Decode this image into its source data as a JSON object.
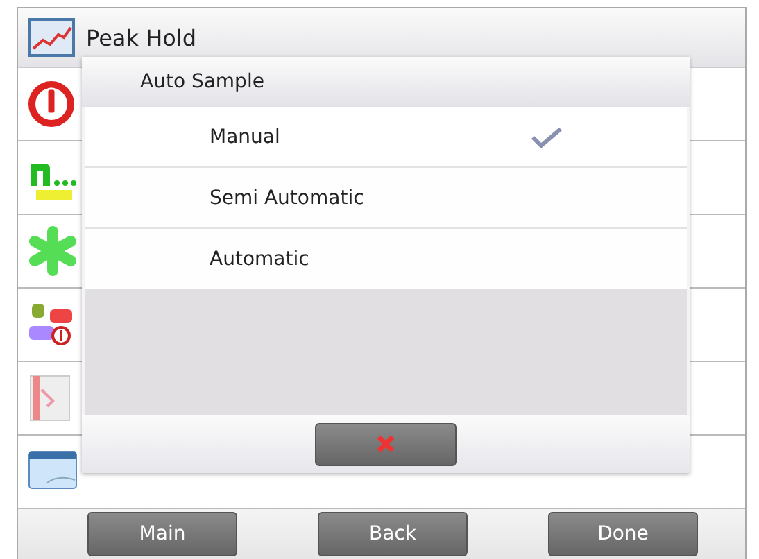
{
  "screen": {
    "title": "Peak Hold"
  },
  "menu_rows": [
    {
      "kind": "power"
    },
    {
      "kind": "auto"
    },
    {
      "kind": "star"
    },
    {
      "kind": "units"
    },
    {
      "kind": "book"
    },
    {
      "kind": "window"
    }
  ],
  "dialog": {
    "title": "Auto Sample",
    "options": [
      {
        "label": "Manual",
        "selected": true
      },
      {
        "label": "Semi Automatic",
        "selected": false
      },
      {
        "label": "Automatic",
        "selected": false
      }
    ]
  },
  "footer_buttons": [
    {
      "label": "Main"
    },
    {
      "label": "Back"
    },
    {
      "label": "Done"
    }
  ]
}
